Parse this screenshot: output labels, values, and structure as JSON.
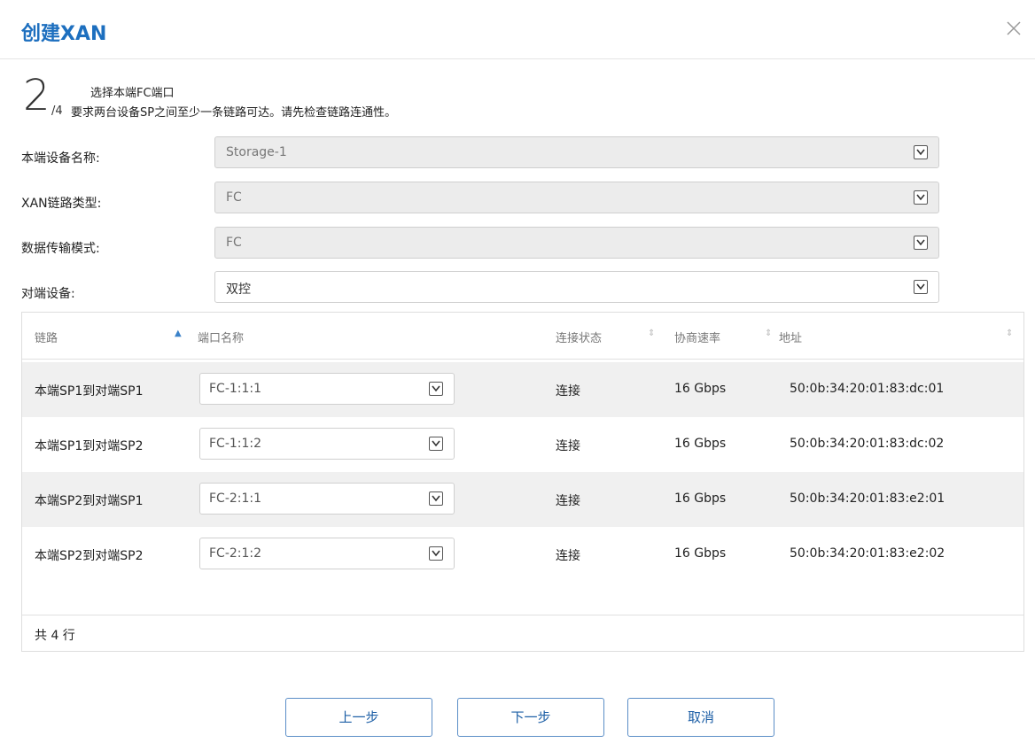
{
  "dialog": {
    "title": "创建XAN"
  },
  "step": {
    "current": "2",
    "total": "/4",
    "title": "选择本端FC端口",
    "description": "要求两台设备SP之间至少一条链路可达。请先检查链路连通性。"
  },
  "form": [
    {
      "label": "本端设备名称:",
      "value": "Storage-1",
      "enabled": false
    },
    {
      "label": "XAN链路类型:",
      "value": "FC",
      "enabled": false
    },
    {
      "label": "数据传输模式:",
      "value": "FC",
      "enabled": false
    },
    {
      "label": "对端设备:",
      "value": "双控",
      "enabled": true
    }
  ],
  "table": {
    "columns": [
      "链路",
      "端口名称",
      "连接状态",
      "协商速率",
      "地址"
    ],
    "rows": [
      {
        "link": "本端SP1到对端SP1",
        "port": "FC-1:1:1",
        "status": "连接",
        "rate": "16 Gbps",
        "address": "50:0b:34:20:01:83:dc:01"
      },
      {
        "link": "本端SP1到对端SP2",
        "port": "FC-1:1:2",
        "status": "连接",
        "rate": "16 Gbps",
        "address": "50:0b:34:20:01:83:dc:02"
      },
      {
        "link": "本端SP2到对端SP1",
        "port": "FC-2:1:1",
        "status": "连接",
        "rate": "16 Gbps",
        "address": "50:0b:34:20:01:83:e2:01"
      },
      {
        "link": "本端SP2到对端SP2",
        "port": "FC-2:1:2",
        "status": "连接",
        "rate": "16 Gbps",
        "address": "50:0b:34:20:01:83:e2:02"
      }
    ],
    "footer": "共 4 行"
  },
  "buttons": {
    "prev": "上一步",
    "next": "下一步",
    "cancel": "取消"
  },
  "colors": {
    "accent": "#1d6fbf",
    "alt_row": "#f0f0f0"
  }
}
